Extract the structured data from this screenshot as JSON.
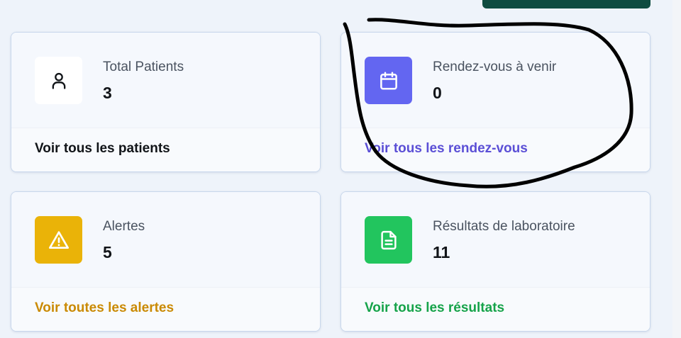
{
  "colors": {
    "background": "#eef3fa",
    "top_button": "#0f4c40",
    "appointments_accent": "#6366f1",
    "alerts_accent": "#eab308",
    "lab_accent": "#22c55e",
    "patients_link": "#111418",
    "appointments_link": "#5b4fd6",
    "alerts_link": "#ca8a04",
    "lab_link": "#16a34a",
    "annotation_ink": "#000000"
  },
  "cards": [
    {
      "id": "patients",
      "icon": "user-icon",
      "label": "Total Patients",
      "value": "3",
      "link": "Voir tous les patients"
    },
    {
      "id": "appointments",
      "icon": "calendar-icon",
      "label": "Rendez-vous à venir",
      "value": "0",
      "link": "Voir tous les rendez-vous"
    },
    {
      "id": "alerts",
      "icon": "warning-icon",
      "label": "Alertes",
      "value": "5",
      "link": "Voir toutes les alertes"
    },
    {
      "id": "lab",
      "icon": "document-icon",
      "label": "Résultats de laboratoire",
      "value": "11",
      "link": "Voir tous les résultats"
    }
  ]
}
